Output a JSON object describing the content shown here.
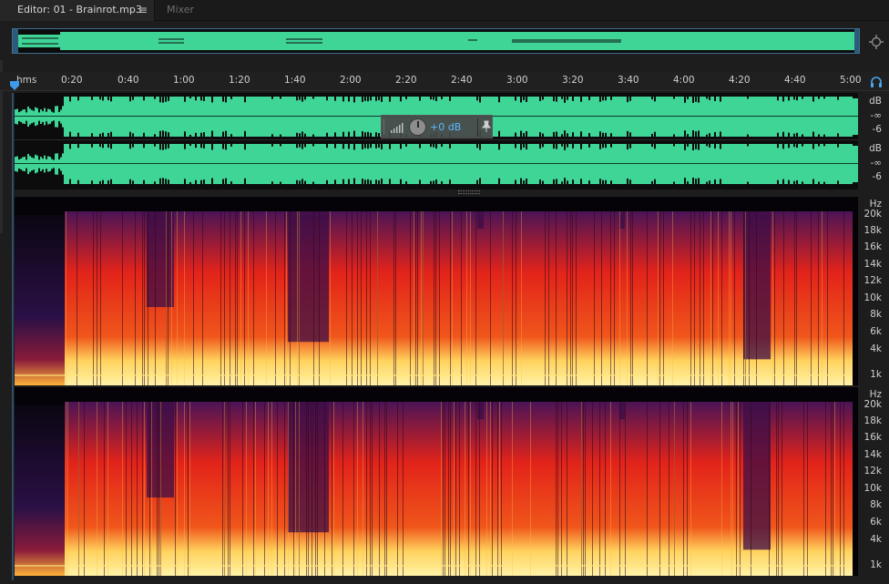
{
  "tabs": {
    "editor_label": "Editor: 01 - Brainrot.mp3",
    "menu_glyph": "≡",
    "mixer_label": "Mixer"
  },
  "ruler": {
    "unit_label": "hms",
    "ticks": [
      "0:20",
      "0:40",
      "1:00",
      "1:20",
      "1:40",
      "2:00",
      "2:20",
      "2:40",
      "3:00",
      "3:20",
      "3:40",
      "4:00",
      "4:20",
      "4:40",
      "5:00"
    ]
  },
  "db_scale": {
    "top": {
      "unit": "dB",
      "inf": "-∞",
      "minus6": "-6"
    },
    "bottom": {
      "unit": "dB",
      "inf": "-∞",
      "minus6": "-6"
    }
  },
  "hud": {
    "volume_value": "+0 dB"
  },
  "hz_scale": {
    "top": {
      "unit": "Hz",
      "labels": [
        "20k",
        "18k",
        "16k",
        "14k",
        "12k",
        "10k",
        "8k",
        "6k",
        "4k",
        "1k"
      ]
    },
    "bottom": {
      "unit": "Hz",
      "labels": [
        "20k",
        "18k",
        "16k",
        "14k",
        "12k",
        "10k",
        "8k",
        "6k",
        "4k",
        "1k"
      ]
    }
  },
  "colors": {
    "waveform": "#3ed597",
    "accent": "#3d9be9",
    "spectral_low": "#ffd35e",
    "spectral_mid": "#e2231a",
    "spectral_high": "#4b1456"
  }
}
